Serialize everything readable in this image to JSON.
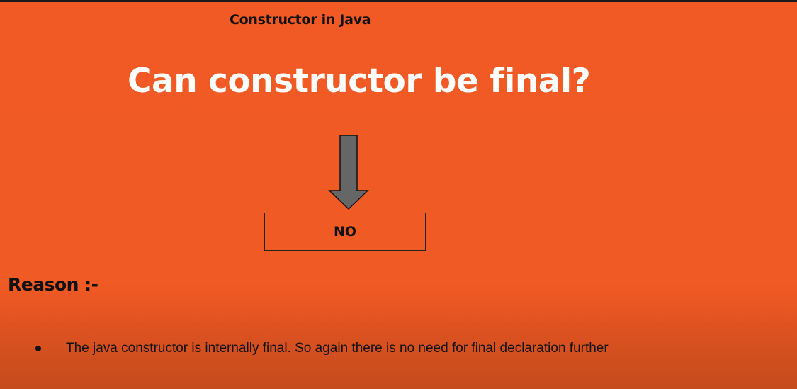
{
  "slide": {
    "subtitle": "Constructor in Java",
    "title": "Can constructor be final?",
    "answer": "NO",
    "reason_heading": "Reason :-",
    "bullets": [
      "The java constructor is internally final. So again there is no need for final declaration further"
    ]
  },
  "colors": {
    "background": "#f15a24",
    "arrow": "#666666"
  }
}
